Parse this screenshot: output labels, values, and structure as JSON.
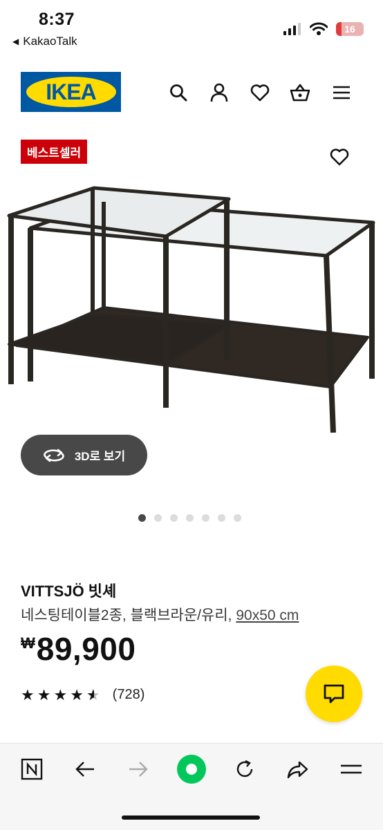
{
  "status": {
    "time": "8:37",
    "back_app": "KakaoTalk",
    "battery": "16"
  },
  "header": {
    "logo_text": "IKEA",
    "icons": [
      "search-icon",
      "user-icon",
      "heart-icon",
      "basket-icon",
      "menu-icon"
    ]
  },
  "badge": "베스트셀러",
  "view3d_label": "3D로 보기",
  "carousel": {
    "count": 7,
    "active": 0
  },
  "product": {
    "name": "VITTSJÖ 빗셰",
    "desc": "네스팅테이블2종, 블랙브라운/유리, ",
    "dimension": "90x50 cm",
    "currency": "₩",
    "price": "89,900",
    "rating": 4.5,
    "reviews": "(728)"
  },
  "colors": {
    "brand_blue": "#0058a3",
    "brand_yellow": "#ffdb00",
    "badge_red": "#cc0008",
    "naver_green": "#03c75a"
  }
}
